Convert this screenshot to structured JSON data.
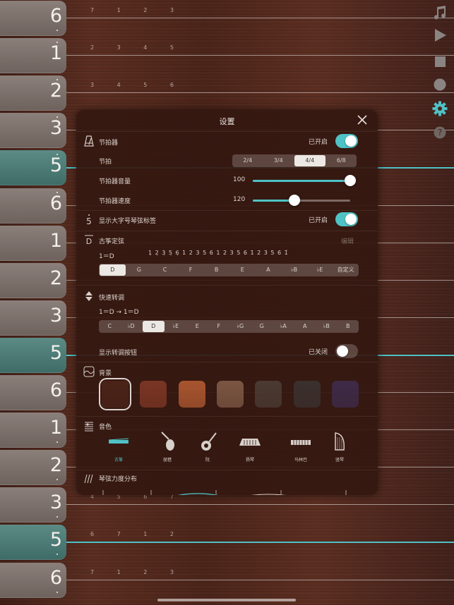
{
  "colors": {
    "accent": "#4fc2c6",
    "panel": "#34180f",
    "tab": "#7d716c",
    "tab_highlight": "#4d7b76"
  },
  "strings": [
    {
      "num": "6",
      "dot": "below",
      "hl": false,
      "hint": "7 1 2 3"
    },
    {
      "num": "1",
      "dot": "above",
      "hl": false,
      "hint": "2 3 4 5"
    },
    {
      "num": "2",
      "dot": "above",
      "hl": false,
      "hint": "3 4 5 6"
    },
    {
      "num": "3",
      "dot": "above",
      "hl": false,
      "hint": ""
    },
    {
      "num": "5",
      "dot": "above",
      "hl": true,
      "hint": ""
    },
    {
      "num": "6",
      "dot": "above",
      "hl": false,
      "hint": ""
    },
    {
      "num": "1",
      "dot": "none",
      "hl": false,
      "hint": ""
    },
    {
      "num": "2",
      "dot": "none",
      "hl": false,
      "hint": ""
    },
    {
      "num": "3",
      "dot": "none",
      "hl": false,
      "hint": ""
    },
    {
      "num": "5",
      "dot": "none",
      "hl": true,
      "hint": ""
    },
    {
      "num": "6",
      "dot": "none",
      "hl": false,
      "hint": ""
    },
    {
      "num": "1",
      "dot": "below",
      "hl": false,
      "hint": ""
    },
    {
      "num": "2",
      "dot": "below",
      "hl": false,
      "hint": ""
    },
    {
      "num": "3",
      "dot": "below",
      "hl": false,
      "hint": "4 5 6 7"
    },
    {
      "num": "5",
      "dot": "below",
      "hl": true,
      "hint": "6 7 1 2"
    },
    {
      "num": "6",
      "dot": "below",
      "hl": false,
      "hint": "7 1 2 3"
    }
  ],
  "sidebar": {
    "icons": [
      "music-note-icon",
      "play-icon",
      "stop-icon",
      "record-icon",
      "gear-icon",
      "help-icon"
    ]
  },
  "settings": {
    "title": "设置",
    "metronome": {
      "label": "节拍器",
      "status": "已开启",
      "on": true
    },
    "beat": {
      "label": "节拍",
      "options": [
        "2/4",
        "3/4",
        "4/4",
        "6/8"
      ],
      "selected": "4/4"
    },
    "volume": {
      "label": "节拍器音量",
      "value": "100",
      "level": 1.0
    },
    "speed": {
      "label": "节拍器速度",
      "value": "120",
      "level": 0.43
    },
    "big_label": {
      "label": "显示大字号琴弦标签",
      "status": "已开启",
      "on": true
    },
    "tuning": {
      "label": "古筝定弦",
      "edit": "编辑",
      "key_text": "1＝D",
      "notes": "1̣ 2̣ 3̣ 5̣ 6̣ 1 2 3 5 6 1 2 3 5 6 1̇ 2̇ 3̇ 5̇ 6̇ 1̈",
      "keys": [
        "D",
        "G",
        "C",
        "F",
        "B",
        "E",
        "A",
        "♭B",
        "♭E",
        "自定义"
      ],
      "selected": "D"
    },
    "transpose": {
      "label": "快速转调",
      "formula": "1＝D → 1＝D",
      "keys": [
        "C",
        "♭D",
        "D",
        "♭E",
        "E",
        "F",
        "♭G",
        "G",
        "♭A",
        "A",
        "♭B",
        "B"
      ],
      "selected": "D"
    },
    "transpose_button": {
      "label": "显示转调按钮",
      "status": "已关闭",
      "on": false
    },
    "background": {
      "label": "背景",
      "swatches": [
        "#4a2218",
        "#7a3524",
        "#a8552f",
        "#7a5642",
        "#4a3a32",
        "#3a302e",
        "#3e2a48"
      ],
      "selected": 0
    },
    "timbre": {
      "label": "音色",
      "instruments": [
        "古筝",
        "琵琶",
        "阮",
        "扬琴",
        "马林巴",
        "竖琴"
      ],
      "selected": 0
    },
    "force": {
      "label": "琴弦力度分布"
    }
  }
}
